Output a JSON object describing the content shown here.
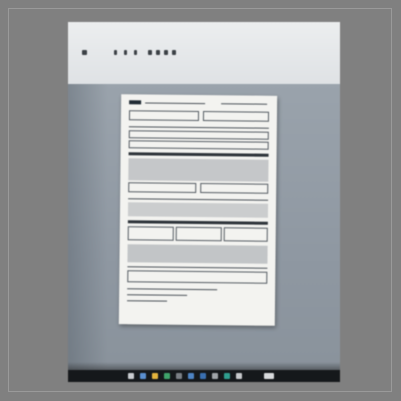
{
  "image": {
    "frame_color": "#808080",
    "subject": "photo-of-monitor-showing-form",
    "colors": {
      "background": "#808080",
      "screen": "#8e969f",
      "paper": "#f3f3f0",
      "taskbar": "#15181b"
    }
  }
}
